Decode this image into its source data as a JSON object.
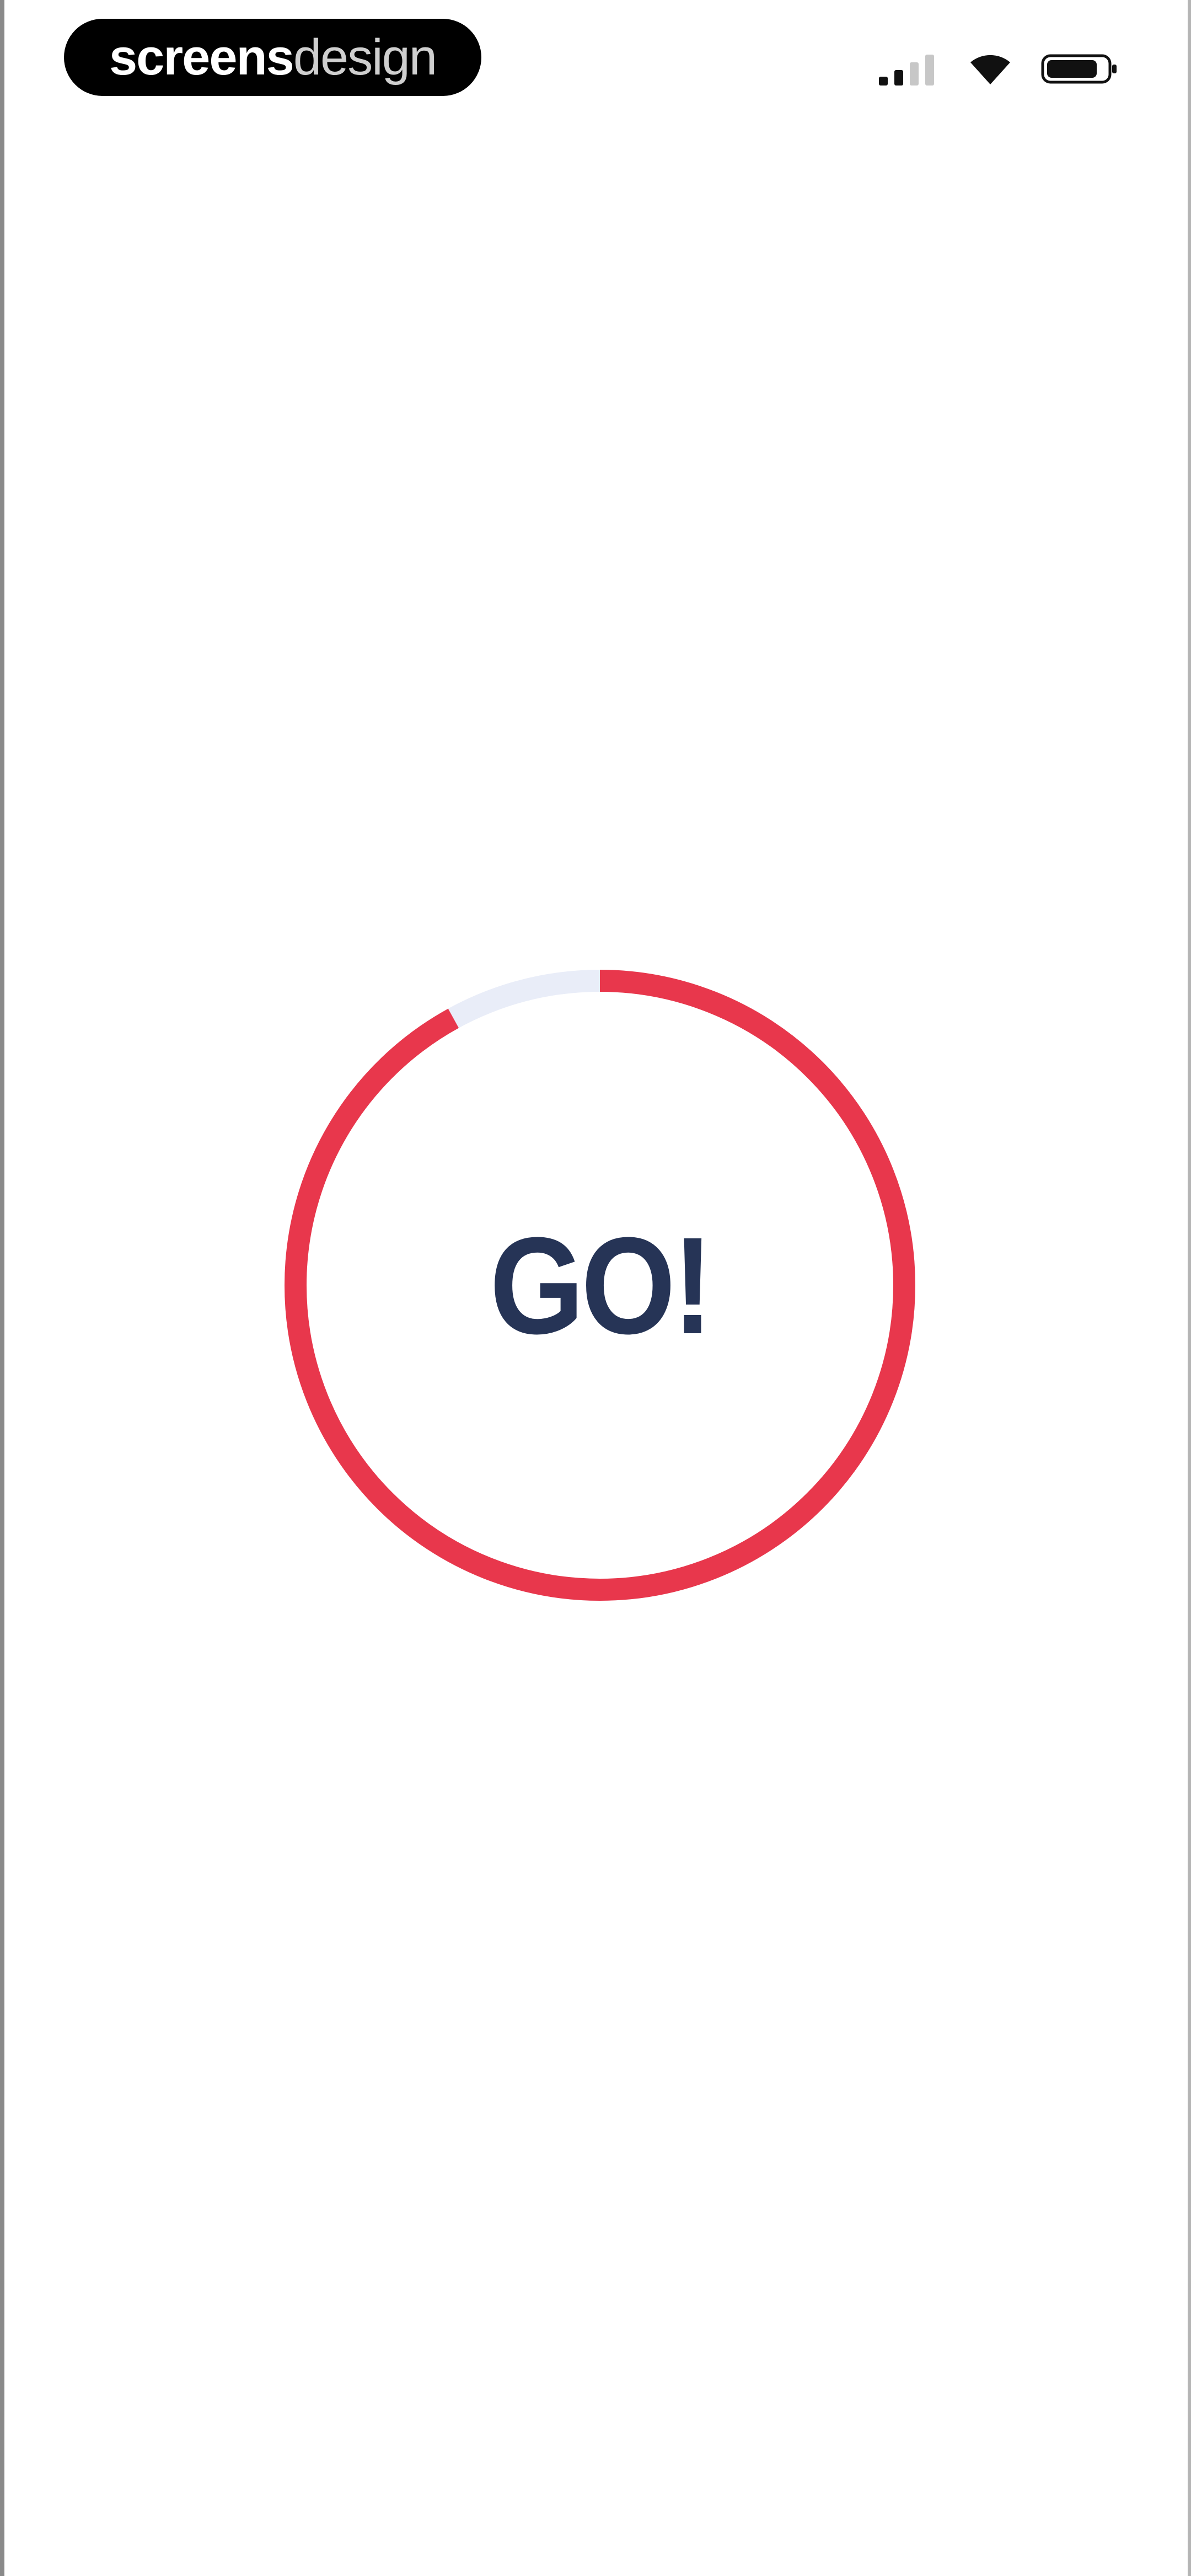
{
  "status_bar": {
    "brand": {
      "strong": "screens",
      "light": "design"
    },
    "icons": [
      "signal-icon",
      "wifi-icon",
      "battery-icon"
    ]
  },
  "countdown": {
    "label": "GO!",
    "progress": 0.92,
    "colors": {
      "ring": "#e8374c",
      "track": "#e9edf8",
      "text": "#263456"
    }
  }
}
